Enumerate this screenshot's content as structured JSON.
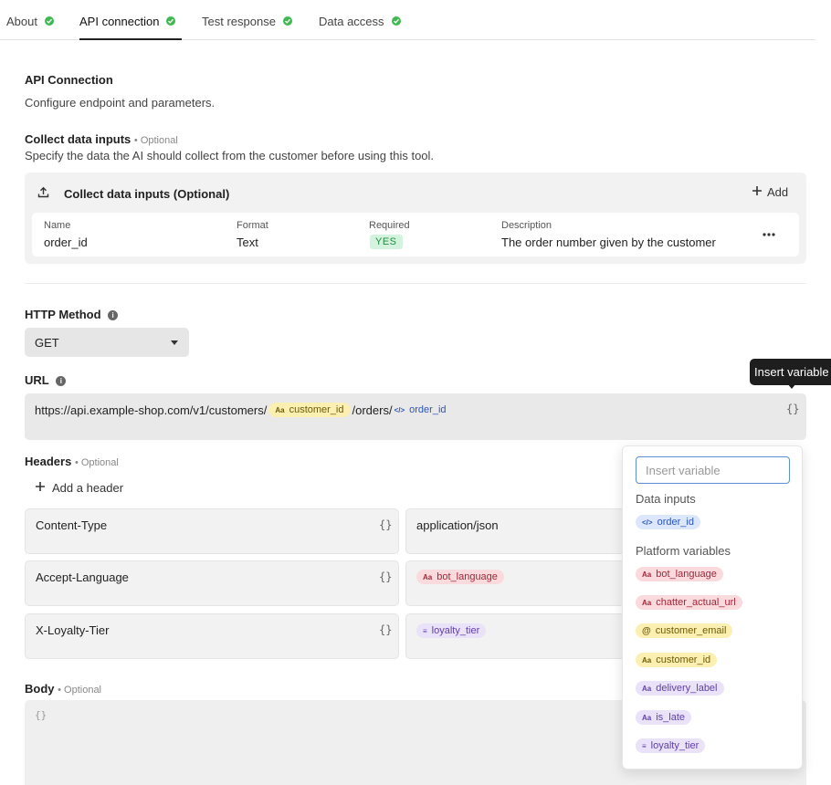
{
  "tabs": [
    {
      "label": "About"
    },
    {
      "label": "API connection"
    },
    {
      "label": "Test response"
    },
    {
      "label": "Data access"
    }
  ],
  "section": {
    "title": "API Connection",
    "subtitle": "Configure endpoint and parameters."
  },
  "collect": {
    "title": "Collect data inputs",
    "optional": "• Optional",
    "description": "Specify the data the AI should collect from the customer before using this tool.",
    "card_title": "Collect data inputs (Optional)",
    "add_label": "Add",
    "columns": {
      "name": "Name",
      "format": "Format",
      "required": "Required",
      "description": "Description"
    },
    "row": {
      "name": "order_id",
      "format": "Text",
      "required": "YES",
      "description": "The order number given by the customer"
    }
  },
  "http": {
    "label": "HTTP Method",
    "value": "GET"
  },
  "url": {
    "label": "URL",
    "prefix": "https://api.example-shop.com/v1/customers/",
    "var1": "customer_id",
    "middle": "/orders/",
    "var2": "order_id"
  },
  "tooltip": {
    "text": "Insert variable"
  },
  "headers": {
    "label": "Headers",
    "optional": "• Optional",
    "add_label": "Add a header",
    "rows": [
      {
        "key": "Content-Type",
        "value": "application/json"
      },
      {
        "key": "Accept-Language",
        "value": "bot_language"
      },
      {
        "key": "X-Loyalty-Tier",
        "value": "loyalty_tier"
      }
    ]
  },
  "body": {
    "label": "Body",
    "optional": "• Optional",
    "placeholder": "{}"
  },
  "popup": {
    "placeholder": "Insert variable",
    "data_inputs_label": "Data inputs",
    "data_inputs": [
      {
        "name": "order_id",
        "color": "blue"
      }
    ],
    "platform_label": "Platform variables",
    "platform": [
      {
        "name": "bot_language",
        "color": "red"
      },
      {
        "name": "chatter_actual_url",
        "color": "red"
      },
      {
        "name": "customer_email",
        "color": "yellow"
      },
      {
        "name": "customer_id",
        "color": "yellow"
      },
      {
        "name": "delivery_label",
        "color": "purple"
      },
      {
        "name": "is_late",
        "color": "purple"
      },
      {
        "name": "loyalty_tier",
        "color": "purple"
      }
    ]
  },
  "colors": {
    "check_green": "#3fb950",
    "chip_yellow": "#fbefb2",
    "chip_blue": "#dde7fb",
    "chip_red": "#fadadd",
    "chip_purple": "#e9e2f8",
    "input_focus": "#5b8fd6"
  }
}
